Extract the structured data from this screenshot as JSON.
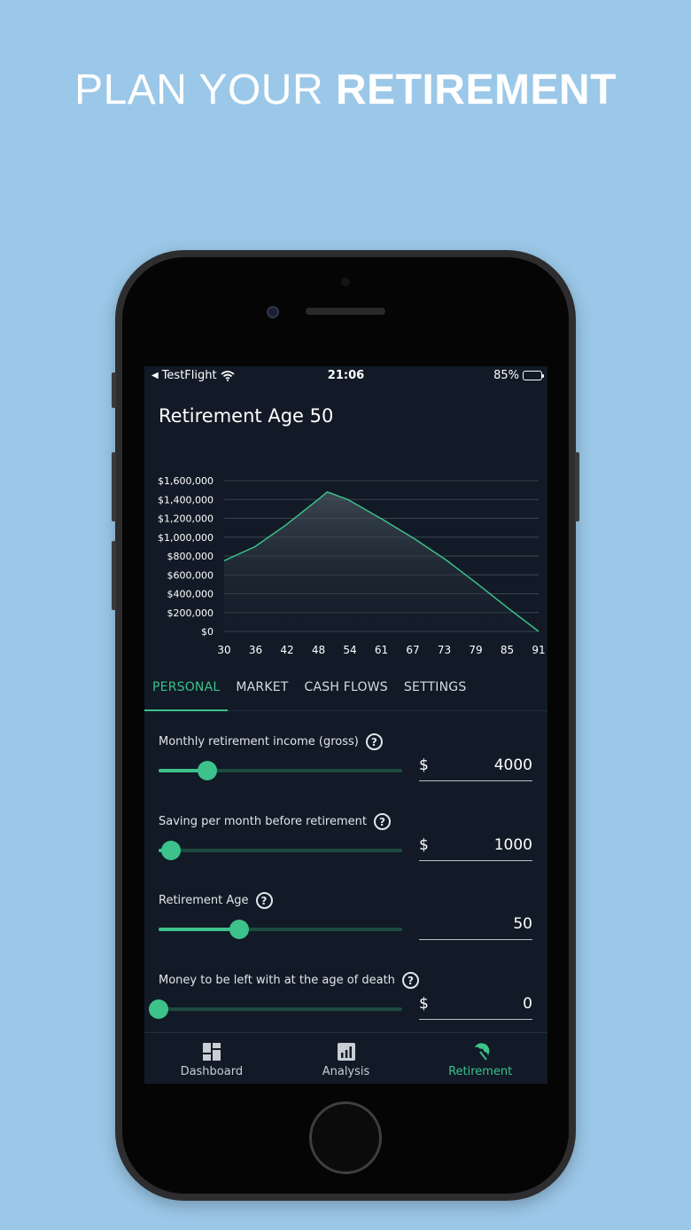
{
  "headline": {
    "light": "PLAN YOUR ",
    "bold": "RETIREMENT"
  },
  "status_bar": {
    "carrier": "TestFlight",
    "time": "21:06",
    "battery": "85%"
  },
  "page_title": "Retirement Age 50",
  "chart_data": {
    "type": "area",
    "x": [
      30,
      36,
      42,
      48,
      50,
      54,
      61,
      67,
      73,
      79,
      85,
      91
    ],
    "y": [
      750000,
      900000,
      1130000,
      1390000,
      1480000,
      1400000,
      1180000,
      980000,
      760000,
      510000,
      250000,
      0
    ],
    "x_tick_labels": [
      "30",
      "36",
      "42",
      "48",
      "54",
      "61",
      "67",
      "73",
      "79",
      "85",
      "91"
    ],
    "y_tick_labels": [
      "$0",
      "$200,000",
      "$400,000",
      "$600,000",
      "$800,000",
      "$1,000,000",
      "$1,200,000",
      "$1,400,000",
      "$1,600,000"
    ],
    "ylim": [
      0,
      1600000
    ],
    "xlim": [
      30,
      91
    ],
    "grid": true,
    "line_color": "#3cc28a"
  },
  "tabs": [
    {
      "label": "PERSONAL",
      "active": true
    },
    {
      "label": "MARKET",
      "active": false
    },
    {
      "label": "CASH FLOWS",
      "active": false
    },
    {
      "label": "SETTINGS",
      "active": false
    }
  ],
  "fields": [
    {
      "label": "Monthly retirement income (gross)",
      "prefix": "$",
      "value": "4000",
      "slider_fraction": 0.2
    },
    {
      "label": "Saving per month before retirement",
      "prefix": "$",
      "value": "1000",
      "slider_fraction": 0.05
    },
    {
      "label": "Retirement Age",
      "prefix": "",
      "value": "50",
      "slider_fraction": 0.33
    },
    {
      "label": "Money to be left with at the age of death",
      "prefix": "$",
      "value": "0",
      "slider_fraction": 0.0
    }
  ],
  "bottom_nav": [
    {
      "label": "Dashboard",
      "icon": "dashboard-icon",
      "active": false
    },
    {
      "label": "Analysis",
      "icon": "analysis-icon",
      "active": false
    },
    {
      "label": "Retirement",
      "icon": "umbrella-icon",
      "active": true
    }
  ],
  "colors": {
    "accent": "#3cc28a",
    "background": "#111a26",
    "page": "#9bc8e8"
  }
}
